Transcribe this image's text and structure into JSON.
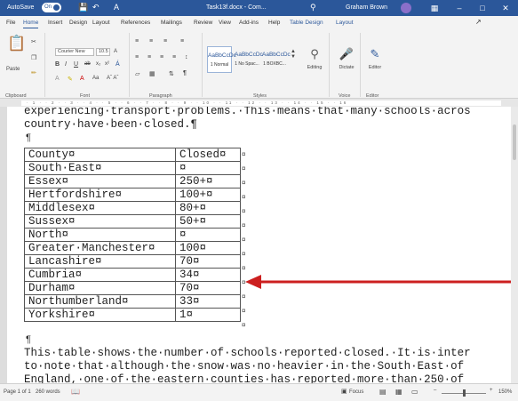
{
  "titlebar": {
    "autosave": "AutoSave",
    "toggle": "On",
    "doc_title": "Task13f.docx - Com... ",
    "user": "Graham Brown"
  },
  "tabs": [
    "File",
    "Home",
    "Insert",
    "Design",
    "Layout",
    "References",
    "Mailings",
    "Review",
    "View",
    "Add-ins",
    "Help",
    "Table Design",
    "Layout"
  ],
  "ribbon": {
    "paste": "Paste",
    "font_name": "Courier New",
    "font_size": "10.5",
    "styles": [
      {
        "preview": "AaBbCcDc",
        "label": "1 Normal"
      },
      {
        "preview": "AaBbCcDc",
        "label": "1 No Spac..."
      },
      {
        "preview": "AaBbCcDc",
        "label": "1 BOXBC..."
      }
    ],
    "editing": "Editing",
    "dictate": "Dictate",
    "editor": "Editor",
    "groups": [
      "Clipboard",
      "Font",
      "Paragraph",
      "Styles",
      "Voice",
      "Editor"
    ]
  },
  "ruler_text": "· 1 · · 2 · · 3 · · 4 · · 5 · · 6 · · 7 · · 8 · · 9 · · 10 · · 11 · · 12 · · 13 · · 14 · · 15 · · 16",
  "document": {
    "line1": "experiencing·transport·problems.·This·means·that·many·schools·acros",
    "line2": "country·have·been·closed.¶",
    "pilcrow": "¶",
    "table_rows": [
      [
        "County¤",
        "Closed¤"
      ],
      [
        "South·East¤",
        "¤"
      ],
      [
        "Essex¤",
        "250+¤"
      ],
      [
        "Hertfordshire¤",
        "100+¤"
      ],
      [
        "Middlesex¤",
        "80+¤"
      ],
      [
        "Sussex¤",
        "50+¤"
      ],
      [
        "North¤",
        "¤"
      ],
      [
        "Greater·Manchester¤",
        "100¤"
      ],
      [
        "Lancashire¤",
        "70¤"
      ],
      [
        "Cumbria¤",
        "34¤"
      ],
      [
        "Durham¤",
        "70¤"
      ],
      [
        "Northumberland¤",
        "33¤"
      ],
      [
        "Yorkshire¤",
        "1¤"
      ]
    ],
    "end_of_row_mark": "¤",
    "after_pilcrow": "¶",
    "para1": "This·table·shows·the·number·of·schools·reported·closed.·It·is·inter",
    "para2": "to·note·that·although·the·snow·was·no·heavier·in·the·South·East·of",
    "para3": "England,·one·of·the·eastern·counties·has·reported·more·than·250·of"
  },
  "annotation": {
    "arrow_color": "#cc1f1f"
  },
  "statusbar": {
    "page": "Page 1 of 1",
    "words": "260 words",
    "focus": "Focus",
    "zoom": "150%"
  },
  "colors": {
    "word_blue": "#2b579a"
  }
}
